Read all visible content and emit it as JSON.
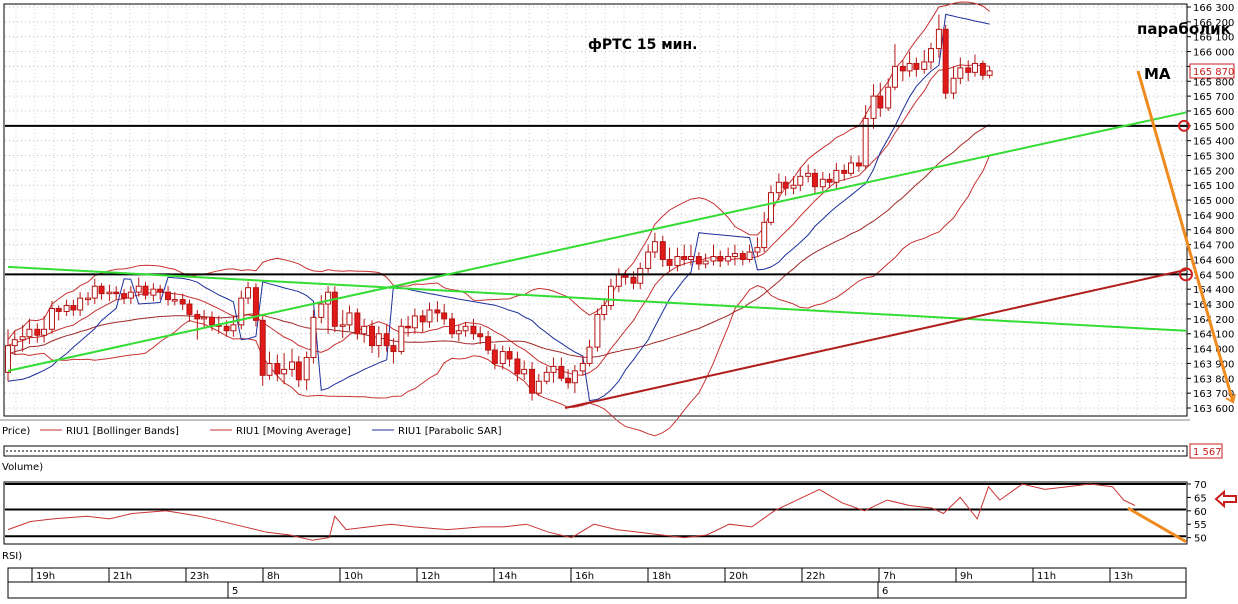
{
  "chart_data": {
    "type": "candlestick",
    "title": "фРТС    15 мин.",
    "annotations": {
      "parabolic": "параболик",
      "ma": "MA"
    },
    "price_axis": {
      "ylim": [
        163600,
        166300
      ],
      "ticks": [
        166300,
        166200,
        166100,
        166000,
        165900,
        165800,
        165700,
        165600,
        165500,
        165400,
        165300,
        165200,
        165100,
        165000,
        164900,
        164800,
        164700,
        164600,
        164500,
        164400,
        164300,
        164200,
        164100,
        164000,
        163900,
        163800,
        163700,
        163600
      ],
      "tick_labels": [
        "166 300",
        "166 200",
        "166 100",
        "166 000",
        "165 900",
        "165 800",
        "165 700",
        "165 600",
        "165 500",
        "165 400",
        "165 300",
        "165 200",
        "165 100",
        "165 000",
        "164 900",
        "164 800",
        "164 700",
        "164 600",
        "164 500",
        "164 400",
        "164 300",
        "164 200",
        "164 100",
        "164 000",
        "163 900",
        "163 800",
        "163 700",
        "163 600"
      ],
      "last_price": "165 870",
      "last_value": 165870
    },
    "legend": {
      "price": "Price)",
      "series": [
        {
          "name": "RIU1 [Bollinger Bands]",
          "color": "#c83232"
        },
        {
          "name": "RIU1 [Moving Average]",
          "color": "#c83232"
        },
        {
          "name": "RIU1 [Parabolic SAR]",
          "color": "#1c2f9c"
        }
      ]
    },
    "volume": {
      "label": "Volume)",
      "value": "1 567"
    },
    "rsi": {
      "label": "RSI)",
      "ylim": [
        48,
        70
      ],
      "ticks": [
        70,
        65,
        60,
        55,
        50
      ],
      "levels": [
        70,
        60.5,
        50.5
      ],
      "x": [
        0,
        0.02,
        0.04,
        0.07,
        0.09,
        0.11,
        0.14,
        0.17,
        0.2,
        0.23,
        0.25,
        0.27,
        0.285,
        0.29,
        0.3,
        0.32,
        0.34,
        0.36,
        0.39,
        0.42,
        0.44,
        0.46,
        0.48,
        0.5,
        0.52,
        0.54,
        0.56,
        0.58,
        0.6,
        0.62,
        0.64,
        0.66,
        0.68,
        0.7,
        0.72,
        0.74,
        0.76,
        0.78,
        0.8,
        0.82,
        0.83,
        0.845,
        0.86,
        0.87,
        0.88,
        0.9,
        0.92,
        0.94,
        0.96,
        0.98,
        0.99,
        1.0
      ],
      "values": [
        53,
        56,
        57,
        58,
        57,
        59,
        60,
        58,
        55,
        52,
        51,
        49,
        50,
        58,
        53,
        54,
        55,
        54,
        53,
        54,
        54,
        55,
        52,
        50,
        55,
        53,
        52,
        51,
        50,
        51,
        55,
        54,
        60,
        64,
        68,
        63,
        60,
        64,
        62,
        61,
        59,
        65,
        57,
        69,
        64,
        70,
        68,
        69,
        70,
        69,
        64,
        62
      ]
    },
    "time_axis": {
      "labels": [
        "19h",
        "21h",
        "23h",
        "8h",
        "10h",
        "12h",
        "14h",
        "16h",
        "18h",
        "20h",
        "22h",
        "7h",
        "9h",
        "11h",
        "13h"
      ],
      "dates": [
        "5",
        "6"
      ]
    },
    "candles": [
      [
        0.0,
        163840,
        164020,
        163780,
        164130
      ],
      [
        0.006,
        164020,
        164060,
        163960,
        164120
      ],
      [
        0.013,
        164060,
        164080,
        163980,
        164160
      ],
      [
        0.019,
        164080,
        164130,
        164030,
        164200
      ],
      [
        0.026,
        164130,
        164090,
        164040,
        164170
      ],
      [
        0.032,
        164090,
        164130,
        164040,
        164220
      ],
      [
        0.039,
        164130,
        164270,
        164100,
        164320
      ],
      [
        0.045,
        164270,
        164250,
        164190,
        164290
      ],
      [
        0.052,
        164250,
        164290,
        164220,
        164330
      ],
      [
        0.058,
        164290,
        164260,
        164220,
        164330
      ],
      [
        0.064,
        164260,
        164340,
        164220,
        164380
      ],
      [
        0.071,
        164340,
        164340,
        164290,
        164380
      ],
      [
        0.077,
        164340,
        164420,
        164300,
        164470
      ],
      [
        0.083,
        164420,
        164370,
        164330,
        164440
      ],
      [
        0.09,
        164370,
        164380,
        164320,
        164430
      ],
      [
        0.096,
        164380,
        164370,
        164330,
        164420
      ],
      [
        0.103,
        164370,
        164340,
        164300,
        164400
      ],
      [
        0.109,
        164340,
        164380,
        164300,
        164420
      ],
      [
        0.116,
        164380,
        164420,
        164350,
        164480
      ],
      [
        0.122,
        164420,
        164360,
        164330,
        164450
      ],
      [
        0.129,
        164360,
        164400,
        164320,
        164440
      ],
      [
        0.135,
        164400,
        164380,
        164330,
        164430
      ],
      [
        0.142,
        164380,
        164330,
        164290,
        164420
      ],
      [
        0.148,
        164330,
        164330,
        164290,
        164380
      ],
      [
        0.155,
        164330,
        164300,
        164260,
        164370
      ],
      [
        0.161,
        164300,
        164230,
        164180,
        164330
      ],
      [
        0.168,
        164230,
        164200,
        164060,
        164260
      ],
      [
        0.174,
        164200,
        164210,
        164140,
        164260
      ],
      [
        0.181,
        164210,
        164160,
        164120,
        164250
      ],
      [
        0.187,
        164160,
        164150,
        164100,
        164220
      ],
      [
        0.194,
        164150,
        164120,
        164080,
        164190
      ],
      [
        0.2,
        164120,
        164160,
        164080,
        164220
      ],
      [
        0.207,
        164160,
        164340,
        164130,
        164390
      ],
      [
        0.213,
        164340,
        164410,
        164300,
        164450
      ],
      [
        0.22,
        164410,
        164190,
        164150,
        164440
      ],
      [
        0.226,
        164190,
        163820,
        163750,
        164230
      ],
      [
        0.232,
        163820,
        163900,
        163790,
        163980
      ],
      [
        0.239,
        163900,
        163830,
        163780,
        163960
      ],
      [
        0.245,
        163830,
        163860,
        163760,
        163970
      ],
      [
        0.252,
        163860,
        163910,
        163810,
        164000
      ],
      [
        0.258,
        163910,
        163790,
        163740,
        163950
      ],
      [
        0.265,
        163790,
        163940,
        163720,
        163980
      ],
      [
        0.271,
        163940,
        164210,
        163900,
        164260
      ],
      [
        0.278,
        164210,
        164300,
        164170,
        164360
      ],
      [
        0.284,
        164300,
        164380,
        164100,
        164420
      ],
      [
        0.29,
        164380,
        164150,
        164110,
        164420
      ],
      [
        0.297,
        164150,
        164160,
        164070,
        164260
      ],
      [
        0.303,
        164160,
        164240,
        164120,
        164290
      ],
      [
        0.31,
        164240,
        164100,
        164060,
        164270
      ],
      [
        0.316,
        164100,
        164150,
        164040,
        164200
      ],
      [
        0.323,
        164150,
        164020,
        163970,
        164190
      ],
      [
        0.329,
        164020,
        164100,
        163940,
        164150
      ],
      [
        0.336,
        164100,
        164020,
        163980,
        164160
      ],
      [
        0.342,
        164020,
        163980,
        163900,
        164070
      ],
      [
        0.349,
        163980,
        164150,
        163960,
        164200
      ],
      [
        0.355,
        164150,
        164140,
        164080,
        164220
      ],
      [
        0.361,
        164140,
        164220,
        164100,
        164270
      ],
      [
        0.368,
        164220,
        164180,
        164110,
        164260
      ],
      [
        0.374,
        164180,
        164260,
        164140,
        164310
      ],
      [
        0.381,
        164260,
        164240,
        164180,
        164320
      ],
      [
        0.387,
        164240,
        164200,
        164160,
        164300
      ],
      [
        0.394,
        164200,
        164100,
        164070,
        164240
      ],
      [
        0.4,
        164100,
        164120,
        164050,
        164160
      ],
      [
        0.406,
        164120,
        164150,
        164080,
        164180
      ],
      [
        0.413,
        164150,
        164100,
        164060,
        164200
      ],
      [
        0.419,
        164100,
        164080,
        164030,
        164150
      ],
      [
        0.426,
        164080,
        163990,
        163960,
        164120
      ],
      [
        0.432,
        163990,
        163900,
        163860,
        164030
      ],
      [
        0.439,
        163900,
        163980,
        163860,
        164020
      ],
      [
        0.445,
        163980,
        163930,
        163880,
        164010
      ],
      [
        0.452,
        163930,
        163830,
        163780,
        163980
      ],
      [
        0.458,
        163830,
        163860,
        163790,
        163920
      ],
      [
        0.465,
        163860,
        163700,
        163650,
        163910
      ],
      [
        0.471,
        163700,
        163780,
        163680,
        163830
      ],
      [
        0.478,
        163780,
        163840,
        163760,
        163880
      ],
      [
        0.484,
        163840,
        163880,
        163770,
        163940
      ],
      [
        0.491,
        163880,
        163800,
        163780,
        163940
      ],
      [
        0.497,
        163800,
        163770,
        163730,
        163860
      ],
      [
        0.503,
        163770,
        163850,
        163700,
        163890
      ],
      [
        0.51,
        163850,
        163900,
        163820,
        163950
      ],
      [
        0.516,
        163900,
        164010,
        163880,
        164060
      ],
      [
        0.523,
        164010,
        164230,
        163980,
        164270
      ],
      [
        0.529,
        164230,
        164290,
        164190,
        164330
      ],
      [
        0.535,
        164290,
        164420,
        164260,
        164470
      ],
      [
        0.542,
        164420,
        164500,
        164380,
        164540
      ],
      [
        0.548,
        164500,
        164480,
        164430,
        164530
      ],
      [
        0.555,
        164480,
        164440,
        164400,
        164520
      ],
      [
        0.561,
        164440,
        164540,
        164400,
        164580
      ],
      [
        0.568,
        164540,
        164650,
        164510,
        164700
      ],
      [
        0.574,
        164650,
        164720,
        164610,
        164780
      ],
      [
        0.581,
        164720,
        164600,
        164550,
        164760
      ],
      [
        0.587,
        164600,
        164560,
        164520,
        164680
      ],
      [
        0.594,
        164560,
        164620,
        164520,
        164680
      ],
      [
        0.6,
        164620,
        164600,
        164560,
        164700
      ],
      [
        0.606,
        164600,
        164620,
        164560,
        164700
      ],
      [
        0.613,
        164620,
        164570,
        164530,
        164650
      ],
      [
        0.619,
        164570,
        164590,
        164540,
        164640
      ],
      [
        0.626,
        164590,
        164620,
        164560,
        164700
      ],
      [
        0.632,
        164620,
        164590,
        164550,
        164660
      ],
      [
        0.639,
        164590,
        164620,
        164560,
        164680
      ],
      [
        0.645,
        164620,
        164640,
        164560,
        164700
      ],
      [
        0.652,
        164640,
        164600,
        164560,
        164660
      ],
      [
        0.658,
        164600,
        164650,
        164580,
        164700
      ],
      [
        0.665,
        164650,
        164680,
        164620,
        164750
      ],
      [
        0.671,
        164680,
        164850,
        164650,
        164920
      ],
      [
        0.677,
        164850,
        165050,
        164830,
        165100
      ],
      [
        0.684,
        165050,
        165120,
        165000,
        165180
      ],
      [
        0.69,
        165120,
        165080,
        165030,
        165160
      ],
      [
        0.697,
        165080,
        165100,
        165040,
        165160
      ],
      [
        0.703,
        165100,
        165160,
        165060,
        165220
      ],
      [
        0.71,
        165160,
        165180,
        165120,
        165240
      ],
      [
        0.716,
        165180,
        165090,
        165040,
        165210
      ],
      [
        0.723,
        165090,
        165140,
        165060,
        165190
      ],
      [
        0.729,
        165140,
        165120,
        165080,
        165180
      ],
      [
        0.735,
        165120,
        165200,
        165080,
        165250
      ],
      [
        0.742,
        165200,
        165180,
        165130,
        165240
      ],
      [
        0.748,
        165180,
        165250,
        165160,
        165300
      ],
      [
        0.755,
        165250,
        165230,
        165190,
        165300
      ],
      [
        0.761,
        165230,
        165550,
        165210,
        165640
      ],
      [
        0.768,
        165550,
        165700,
        165480,
        165780
      ],
      [
        0.774,
        165700,
        165620,
        165560,
        165790
      ],
      [
        0.781,
        165620,
        165760,
        165600,
        165820
      ],
      [
        0.787,
        165760,
        165900,
        165740,
        166050
      ],
      [
        0.794,
        165900,
        165870,
        165800,
        165940
      ],
      [
        0.8,
        165870,
        165920,
        165830,
        166000
      ],
      [
        0.806,
        165920,
        165880,
        165830,
        165960
      ],
      [
        0.813,
        165880,
        165930,
        165850,
        166010
      ],
      [
        0.819,
        165930,
        166020,
        165880,
        166060
      ],
      [
        0.826,
        166020,
        166150,
        165960,
        166250
      ],
      [
        0.832,
        166150,
        165720,
        165680,
        166180
      ],
      [
        0.839,
        165720,
        165820,
        165680,
        165900
      ],
      [
        0.845,
        165820,
        165890,
        165780,
        165960
      ],
      [
        0.852,
        165890,
        165860,
        165800,
        165940
      ],
      [
        0.858,
        165860,
        165920,
        165830,
        165980
      ],
      [
        0.865,
        165920,
        165840,
        165810,
        165940
      ],
      [
        0.871,
        165840,
        165870,
        165820,
        165900
      ]
    ]
  }
}
